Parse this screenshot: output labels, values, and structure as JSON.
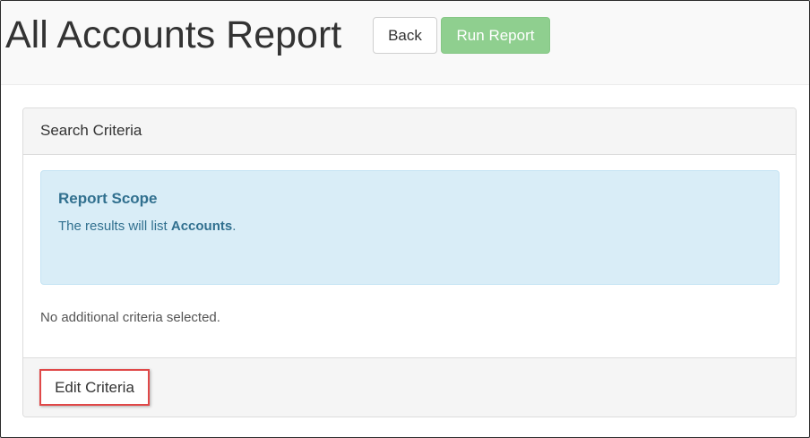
{
  "page": {
    "title": "All Accounts Report"
  },
  "toolbar": {
    "back_label": "Back",
    "run_label": "Run Report"
  },
  "panel": {
    "header": "Search Criteria",
    "scope": {
      "title": "Report Scope",
      "text_prefix": "The results will list ",
      "text_bold": "Accounts",
      "text_suffix": "."
    },
    "no_criteria": "No additional criteria selected.",
    "edit_label": "Edit Criteria"
  },
  "colors": {
    "run_button_bg": "#8fcf8f",
    "scope_bg": "#d9edf7",
    "scope_text": "#31708f",
    "highlight_border": "#e04848"
  }
}
